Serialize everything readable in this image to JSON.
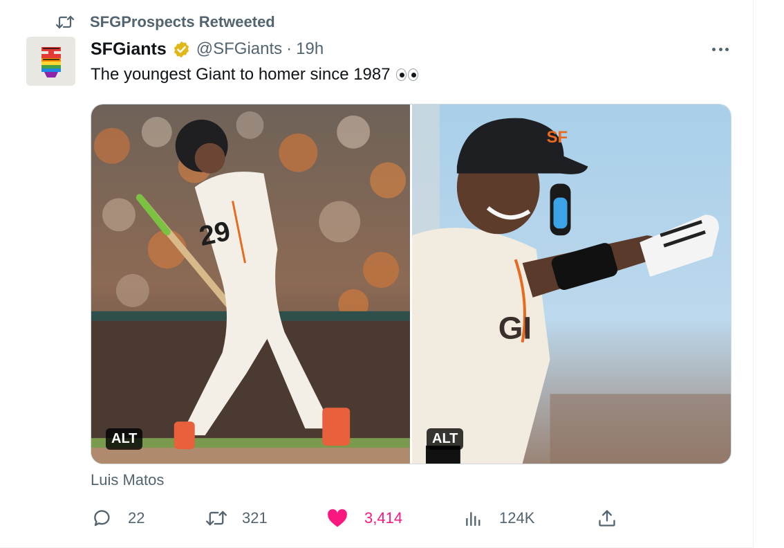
{
  "retweet": {
    "text": "SFGProspects Retweeted",
    "icon": "retweet-icon"
  },
  "author": {
    "display_name": "SFGiants",
    "verified_badge": "verified-gold-badge-icon",
    "handle": "@SFGiants",
    "separator": "·",
    "time": "19h",
    "avatar_icon": "sf-giants-logo-avatar"
  },
  "tweet": {
    "text": "The youngest Giant to homer since 1987",
    "emoji": "eyes-emoji"
  },
  "media": {
    "photos": [
      {
        "alt_label": "ALT",
        "name": "batting-swing-photo"
      },
      {
        "alt_label": "ALT",
        "name": "celebration-photo"
      }
    ]
  },
  "caption": "Luis Matos",
  "actions": {
    "reply": {
      "icon": "reply-bubble-icon",
      "count": "22"
    },
    "retweet": {
      "icon": "retweet-icon",
      "count": "321"
    },
    "like": {
      "icon": "heart-filled-icon",
      "count": "3,414",
      "color": "#f91880"
    },
    "views": {
      "icon": "views-bar-chart-icon",
      "count": "124K"
    },
    "share": {
      "icon": "share-upload-icon"
    }
  },
  "colors": {
    "secondary_text": "#536471",
    "primary_text": "#0f1419",
    "like_pink": "#f91880",
    "verified_gold": "#e2b719"
  }
}
